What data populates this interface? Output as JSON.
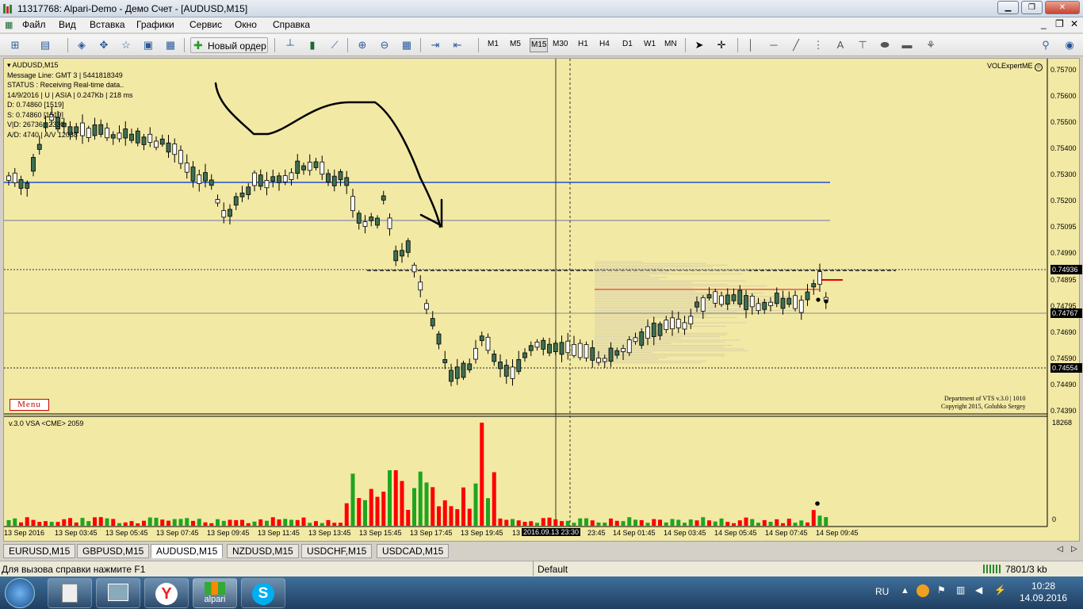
{
  "window": {
    "title": "11317768: Alpari-Demo - Демо Счет - [AUDUSD,M15]"
  },
  "menu": [
    "Файл",
    "Вид",
    "Вставка",
    "Графики",
    "Сервис",
    "Окно",
    "Справка"
  ],
  "toolbar": {
    "new_order": "Новый ордер",
    "timeframes": [
      "M1",
      "M5",
      "M15",
      "M30",
      "H1",
      "H4",
      "D1",
      "W1",
      "MN"
    ],
    "active_timeframe": "M15"
  },
  "chart": {
    "symbol_line": "AUDUSD,M15",
    "info_lines": [
      "Message Line: GMT 3 | 5441818349",
      "STATUS : Receiving Real-time data..",
      "14/9/2016 | U | ASIA | 0.247Kb | 218 ms",
      "D: 0.74860 [1519]",
      "S: 0.74860 [1519]",
      "V|D: 26736 | 2330",
      "A/D: 4740 | A/V 12038"
    ],
    "expert": "VOLExpertME",
    "expert_icon": "smiley-icon",
    "copyright": [
      "Department of VTS  v.3.0 | 1010",
      "Copyright 2015, Golubko Sergey"
    ],
    "menu_button": "Menu",
    "indicator": "v.3.0 VSA <CME> 2059",
    "volume_max": "18268",
    "volume_zero": "0",
    "price_ticks": [
      "0.75700",
      "0.75600",
      "0.75500",
      "0.75400",
      "0.75300",
      "0.75200",
      "0.75095",
      "0.74990",
      "0.74895",
      "0.74795",
      "0.74690",
      "0.74590",
      "0.74490",
      "0.74390"
    ],
    "price_labels": [
      "0.74936",
      "0.74767",
      "0.74554"
    ],
    "time_ticks": [
      "13 Sep 2016",
      "13 Sep 03:45",
      "13 Sep 05:45",
      "13 Sep 07:45",
      "13 Sep 09:45",
      "13 Sep 11:45",
      "13 Sep 13:45",
      "13 Sep 15:45",
      "13 Sep 17:45",
      "13 Sep 19:45",
      "13",
      "23:45",
      "14 Sep 01:45",
      "14 Sep 03:45",
      "14 Sep 05:45",
      "14 Sep 07:45",
      "14 Sep 09:45"
    ],
    "crosshair_time": "2016.09.13 23:30",
    "colors": {
      "bg": "#f2e9a5",
      "bull": "#ffffff",
      "bear": "#3e6f52",
      "vol_up": "#1fa51f",
      "vol_down": "#ff0000",
      "hline_blue": "#1f4fd0",
      "hline_gray": "#9a9aaa"
    }
  },
  "tabs": [
    "EURUSD,M15",
    "GBPUSD,M15",
    "AUDUSD,M15",
    "NZDUSD,M15",
    "USDCHF,M15",
    "USDCAD,M15"
  ],
  "active_tab": "AUDUSD,M15",
  "statusbar": {
    "help": "Для вызова справки нажмите F1",
    "profile": "Default",
    "traffic": "7801/3 kb"
  },
  "taskbar": {
    "lang": "RU",
    "time": "10:28",
    "date": "14.09.2016",
    "alpari": "alpari",
    "apps": [
      "start-orb-icon",
      "calculator-icon",
      "remote-desktop-icon",
      "yandex-browser-icon",
      "alpari-app-icon",
      "skype-icon"
    ]
  }
}
